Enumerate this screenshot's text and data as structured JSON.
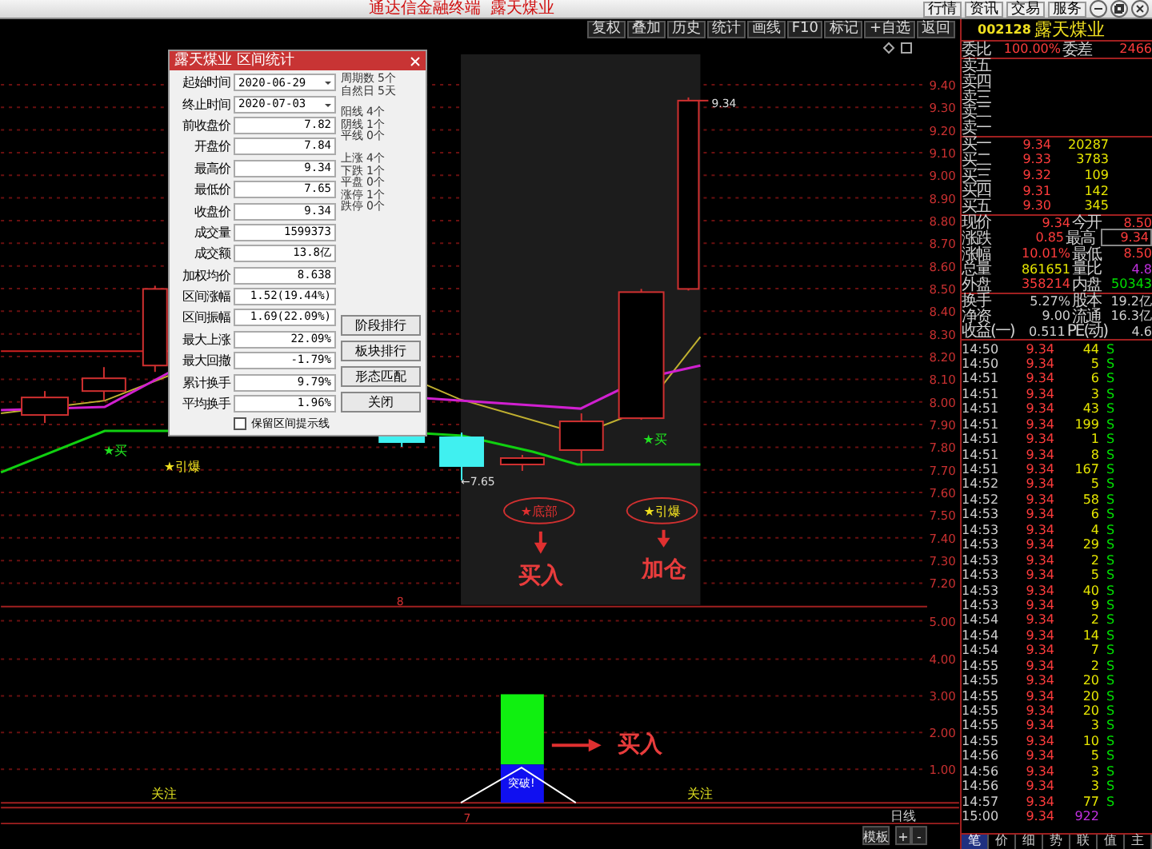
{
  "window": {
    "title": "通达信金融终端  露天煤业",
    "menu": [
      "行情",
      "资讯",
      "交易",
      "服务"
    ]
  },
  "toolbar": [
    "复权",
    "叠加",
    "历史",
    "统计",
    "画线",
    "F10",
    "标记",
    "+自选",
    "返回"
  ],
  "stock": {
    "code": "002128",
    "name": "露天煤业"
  },
  "dialog": {
    "title": "露天煤业 区间统计",
    "dates": [
      {
        "label": "起始时间",
        "value": "2020-06-29"
      },
      {
        "label": "终止时间",
        "value": "2020-07-03"
      }
    ],
    "fields": [
      {
        "label": "前收盘价",
        "value": "7.82"
      },
      {
        "label": "开盘价",
        "value": "7.84"
      },
      {
        "label": "最高价",
        "value": "9.34"
      },
      {
        "label": "最低价",
        "value": "7.65"
      },
      {
        "label": "收盘价",
        "value": "9.34"
      },
      {
        "label": "成交量",
        "value": "1599373"
      },
      {
        "label": "成交额",
        "value": "13.8亿"
      },
      {
        "label": "加权均价",
        "value": "8.638"
      },
      {
        "label": "区间涨幅",
        "value": "1.52(19.44%)"
      },
      {
        "label": "区间振幅",
        "value": "1.69(22.09%)"
      },
      {
        "label": "最大上涨",
        "value": "22.09%"
      },
      {
        "label": "最大回撤",
        "value": "-1.79%"
      },
      {
        "label": "累计换手",
        "value": "9.79%"
      },
      {
        "label": "平均换手",
        "value": "1.96%"
      }
    ],
    "summary": [
      [
        {
          "label": "周期数",
          "value": "5个"
        },
        {
          "label": "自然日",
          "value": "5天"
        }
      ],
      [
        {
          "label": "阳线",
          "value": "4个"
        },
        {
          "label": "阴线",
          "value": "1个"
        },
        {
          "label": "平线",
          "value": "0个"
        }
      ],
      [
        {
          "label": "上涨",
          "value": "4个"
        },
        {
          "label": "下跌",
          "value": "1个"
        },
        {
          "label": "平盘",
          "value": "0个"
        },
        {
          "label": "涨停",
          "value": "1个"
        },
        {
          "label": "跌停",
          "value": "0个"
        }
      ]
    ],
    "buttons": [
      "阶段排行",
      "板块排行",
      "形态匹配",
      "关闭"
    ],
    "checkbox": {
      "label": "保留区间提示线",
      "checked": false
    }
  },
  "chart": {
    "price_axis": [
      "9.40",
      "9.30",
      "9.20",
      "9.10",
      "9.00",
      "8.90",
      "8.80",
      "8.70",
      "8.60",
      "8.50",
      "8.40",
      "8.30",
      "8.20",
      "8.10",
      "8.00",
      "7.90",
      "7.80",
      "7.70",
      "7.60",
      "7.50",
      "7.40",
      "7.30",
      "7.20"
    ],
    "indicator_axis": [
      "5.00",
      "4.00",
      "3.00",
      "2.00",
      "1.00"
    ],
    "labels": [
      {
        "kind": "price",
        "text": "9.34"
      },
      {
        "kind": "price",
        "text": "←7.65"
      },
      {
        "kind": "buy",
        "text": "★买"
      },
      {
        "kind": "burst",
        "text": "★引爆"
      },
      {
        "kind": "buy",
        "text": "★买"
      },
      {
        "kind": "callout",
        "text": "★底部"
      },
      {
        "kind": "burst-callout",
        "text": "★引爆"
      },
      {
        "kind": "note",
        "text": "买入"
      },
      {
        "kind": "note",
        "text": "加仓"
      },
      {
        "kind": "marker",
        "text": "8"
      },
      {
        "kind": "bar",
        "text": "突破!"
      },
      {
        "kind": "note",
        "text": "买入"
      },
      {
        "kind": "focus",
        "text": "关注"
      },
      {
        "kind": "focus",
        "text": "关注"
      },
      {
        "kind": "marker",
        "text": "7"
      },
      {
        "kind": "plain",
        "text": "日线"
      }
    ],
    "controls": [
      "模板",
      "+",
      "-"
    ]
  },
  "quote": {
    "ratio": [
      {
        "label": "委比",
        "value": "100.00%"
      },
      {
        "label": "委差",
        "value": "2466"
      }
    ],
    "sell": [
      {
        "label": "卖五"
      },
      {
        "label": "卖四"
      },
      {
        "label": "卖三"
      },
      {
        "label": "卖二"
      },
      {
        "label": "卖一"
      }
    ],
    "buy": [
      {
        "label": "买一",
        "price": "9.34",
        "volume": "20287"
      },
      {
        "label": "买二",
        "price": "9.33",
        "volume": "3783"
      },
      {
        "label": "买三",
        "price": "9.32",
        "volume": "109"
      },
      {
        "label": "买四",
        "price": "9.31",
        "volume": "142"
      },
      {
        "label": "买五",
        "price": "9.30",
        "volume": "345"
      }
    ],
    "stats": [
      [
        {
          "label": "现价",
          "value": "9.34",
          "color": "#ff3c3c"
        },
        {
          "label": "今开",
          "value": "8.50",
          "color": "#ff3c3c"
        }
      ],
      [
        {
          "label": "涨跌",
          "value": "0.85",
          "color": "#ff3c3c"
        },
        {
          "label": "最高",
          "value": "9.34",
          "color": "#ff3c3c"
        }
      ],
      [
        {
          "label": "涨幅",
          "value": "10.01%",
          "color": "#ff3c3c"
        },
        {
          "label": "最低",
          "value": "8.50",
          "color": "#ff3c3c"
        }
      ],
      [
        {
          "label": "总量",
          "value": "861651",
          "color": "#e6e600"
        },
        {
          "label": "量比",
          "value": "4.8",
          "color": "#c030e0"
        }
      ],
      [
        {
          "label": "外盘",
          "value": "358214",
          "color": "#ff3c3c"
        },
        {
          "label": "内盘",
          "value": "50343",
          "color": "#00e000"
        }
      ],
      [
        {
          "label": "换手",
          "value": "5.27%",
          "color": "#d0d0d0"
        },
        {
          "label": "股本",
          "value": "19.2亿",
          "color": "#d0d0d0"
        }
      ],
      [
        {
          "label": "净资",
          "value": "9.00",
          "color": "#d0d0d0"
        },
        {
          "label": "流通",
          "value": "16.3亿",
          "color": "#d0d0d0"
        }
      ],
      [
        {
          "label": "收益(一)",
          "value": "0.511",
          "color": "#d0d0d0"
        },
        {
          "label": "PE(动)",
          "value": "4.6",
          "color": "#d0d0d0"
        }
      ]
    ]
  },
  "ticks": [
    {
      "time": "14:50",
      "price": "9.34",
      "volume": "44",
      "side": "S",
      "color": "#e6e600"
    },
    {
      "time": "14:50",
      "price": "9.34",
      "volume": "5",
      "side": "S",
      "color": "#e6e600"
    },
    {
      "time": "14:51",
      "price": "9.34",
      "volume": "6",
      "side": "S",
      "color": "#e6e600"
    },
    {
      "time": "14:51",
      "price": "9.34",
      "volume": "3",
      "side": "S",
      "color": "#e6e600"
    },
    {
      "time": "14:51",
      "price": "9.34",
      "volume": "43",
      "side": "S",
      "color": "#e6e600"
    },
    {
      "time": "14:51",
      "price": "9.34",
      "volume": "199",
      "side": "S",
      "color": "#e6e600"
    },
    {
      "time": "14:51",
      "price": "9.34",
      "volume": "1",
      "side": "S",
      "color": "#e6e600"
    },
    {
      "time": "14:51",
      "price": "9.34",
      "volume": "8",
      "side": "S",
      "color": "#e6e600"
    },
    {
      "time": "14:51",
      "price": "9.34",
      "volume": "167",
      "side": "S",
      "color": "#e6e600"
    },
    {
      "time": "14:52",
      "price": "9.34",
      "volume": "5",
      "side": "S",
      "color": "#e6e600"
    },
    {
      "time": "14:52",
      "price": "9.34",
      "volume": "58",
      "side": "S",
      "color": "#e6e600"
    },
    {
      "time": "14:53",
      "price": "9.34",
      "volume": "6",
      "side": "S",
      "color": "#e6e600"
    },
    {
      "time": "14:53",
      "price": "9.34",
      "volume": "4",
      "side": "S",
      "color": "#e6e600"
    },
    {
      "time": "14:53",
      "price": "9.34",
      "volume": "29",
      "side": "S",
      "color": "#e6e600"
    },
    {
      "time": "14:53",
      "price": "9.34",
      "volume": "2",
      "side": "S",
      "color": "#e6e600"
    },
    {
      "time": "14:53",
      "price": "9.34",
      "volume": "5",
      "side": "S",
      "color": "#e6e600"
    },
    {
      "time": "14:53",
      "price": "9.34",
      "volume": "40",
      "side": "S",
      "color": "#e6e600"
    },
    {
      "time": "14:53",
      "price": "9.34",
      "volume": "9",
      "side": "S",
      "color": "#e6e600"
    },
    {
      "time": "14:54",
      "price": "9.34",
      "volume": "2",
      "side": "S",
      "color": "#e6e600"
    },
    {
      "time": "14:54",
      "price": "9.34",
      "volume": "14",
      "side": "S",
      "color": "#e6e600"
    },
    {
      "time": "14:54",
      "price": "9.34",
      "volume": "7",
      "side": "S",
      "color": "#e6e600"
    },
    {
      "time": "14:55",
      "price": "9.34",
      "volume": "2",
      "side": "S",
      "color": "#e6e600"
    },
    {
      "time": "14:55",
      "price": "9.34",
      "volume": "20",
      "side": "S",
      "color": "#e6e600"
    },
    {
      "time": "14:55",
      "price": "9.34",
      "volume": "20",
      "side": "S",
      "color": "#e6e600"
    },
    {
      "time": "14:55",
      "price": "9.34",
      "volume": "20",
      "side": "S",
      "color": "#e6e600"
    },
    {
      "time": "14:55",
      "price": "9.34",
      "volume": "3",
      "side": "S",
      "color": "#e6e600"
    },
    {
      "time": "14:55",
      "price": "9.34",
      "volume": "10",
      "side": "S",
      "color": "#e6e600"
    },
    {
      "time": "14:56",
      "price": "9.34",
      "volume": "5",
      "side": "S",
      "color": "#e6e600"
    },
    {
      "time": "14:56",
      "price": "9.34",
      "volume": "3",
      "side": "S",
      "color": "#e6e600"
    },
    {
      "time": "14:56",
      "price": "9.34",
      "volume": "3",
      "side": "S",
      "color": "#e6e600"
    },
    {
      "time": "14:57",
      "price": "9.34",
      "volume": "77",
      "side": "S",
      "color": "#e6e600"
    },
    {
      "time": "15:00",
      "price": "9.34",
      "volume": "922",
      "color": "#c030e0"
    }
  ],
  "panel_tabs": [
    {
      "label": "笔",
      "selected": true
    },
    {
      "label": "价",
      "selected": false
    },
    {
      "label": "细",
      "selected": false
    },
    {
      "label": "势",
      "selected": false
    },
    {
      "label": "联",
      "selected": false
    },
    {
      "label": "值",
      "selected": false
    },
    {
      "label": "主",
      "selected": false
    }
  ]
}
